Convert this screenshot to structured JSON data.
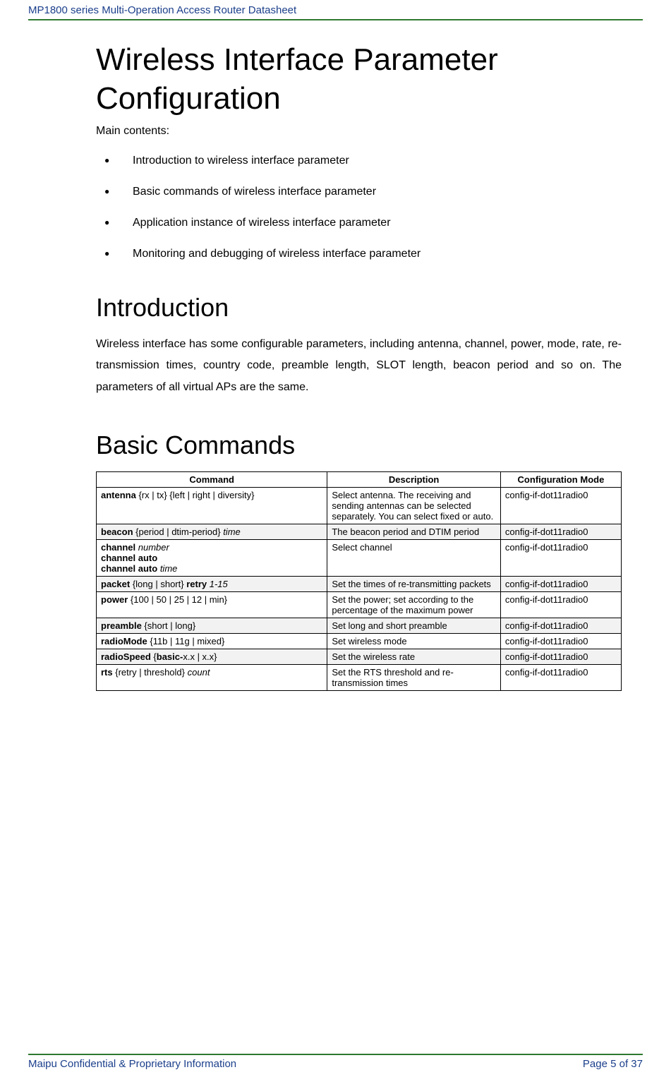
{
  "header": "MP1800 series Multi-Operation Access Router Datasheet",
  "title": "Wireless Interface Parameter Configuration",
  "main_contents_label": "Main contents:",
  "bullets": [
    "Introduction to wireless interface parameter",
    "Basic commands of wireless interface parameter",
    "Application instance of wireless interface parameter",
    "Monitoring and debugging of wireless interface parameter"
  ],
  "intro_heading": "Introduction",
  "intro_para": "Wireless interface has some configurable parameters, including antenna, channel, power, mode, rate, re-transmission times, country code, preamble length, SLOT length, beacon period and so on. The parameters of all virtual APs are the same.",
  "basic_heading": "Basic Commands",
  "table": {
    "headers": {
      "cmd": "Command",
      "desc": "Description",
      "mode": "Configuration Mode"
    },
    "rows": [
      {
        "cmd_html": "<span class='b'>antenna</span> {rx | tx} {left | right | diversity}",
        "desc": "Select antenna. The receiving and sending antennas can be selected separately. You can select fixed or auto.",
        "mode": "config-if-dot11radio0"
      },
      {
        "cmd_html": "<span class='b'>beacon</span> {period | dtim-period} <span class='i'>time</span>",
        "desc": "The beacon period and DTIM period",
        "mode": "config-if-dot11radio0"
      },
      {
        "cmd_html": "<span class='b'>channel</span> <span class='i'>number</span><br><span class='b'>channel auto</span><br><span class='b'>channel auto</span> <span class='i'>time</span>",
        "desc": "Select channel",
        "mode": "config-if-dot11radio0"
      },
      {
        "cmd_html": "<span class='b'>packet</span> {long | short} <span class='b'>retry</span> <span class='i'>1-15</span>",
        "desc": "Set the times of re-transmitting packets",
        "mode": "config-if-dot11radio0"
      },
      {
        "cmd_html": "<span class='b'>power</span> {100 | 50 | 25 | 12 | min}",
        "desc": "Set the power; set according to the percentage of the maximum power",
        "mode": "config-if-dot11radio0"
      },
      {
        "cmd_html": "<span class='b'>preamble</span> {short | long}",
        "desc": "Set long and short preamble",
        "mode": "config-if-dot11radio0"
      },
      {
        "cmd_html": "<span class='b'>radioMode</span> {11b | 11g | mixed}",
        "desc": "Set wireless mode",
        "mode": "config-if-dot11radio0"
      },
      {
        "cmd_html": "<span class='b'>radioSpeed</span> {<span class='b'>basic-</span>x.x | x.x}",
        "desc": "Set the wireless rate",
        "mode": "config-if-dot11radio0"
      },
      {
        "cmd_html": "<span class='b'>rts</span> {retry | threshold} <span class='i'>count</span>",
        "desc": "Set the RTS threshold and re-transmission times",
        "mode": "config-if-dot11radio0"
      }
    ]
  },
  "footer_left": "Maipu Confidential & Proprietary Information",
  "footer_right": "Page 5 of 37"
}
